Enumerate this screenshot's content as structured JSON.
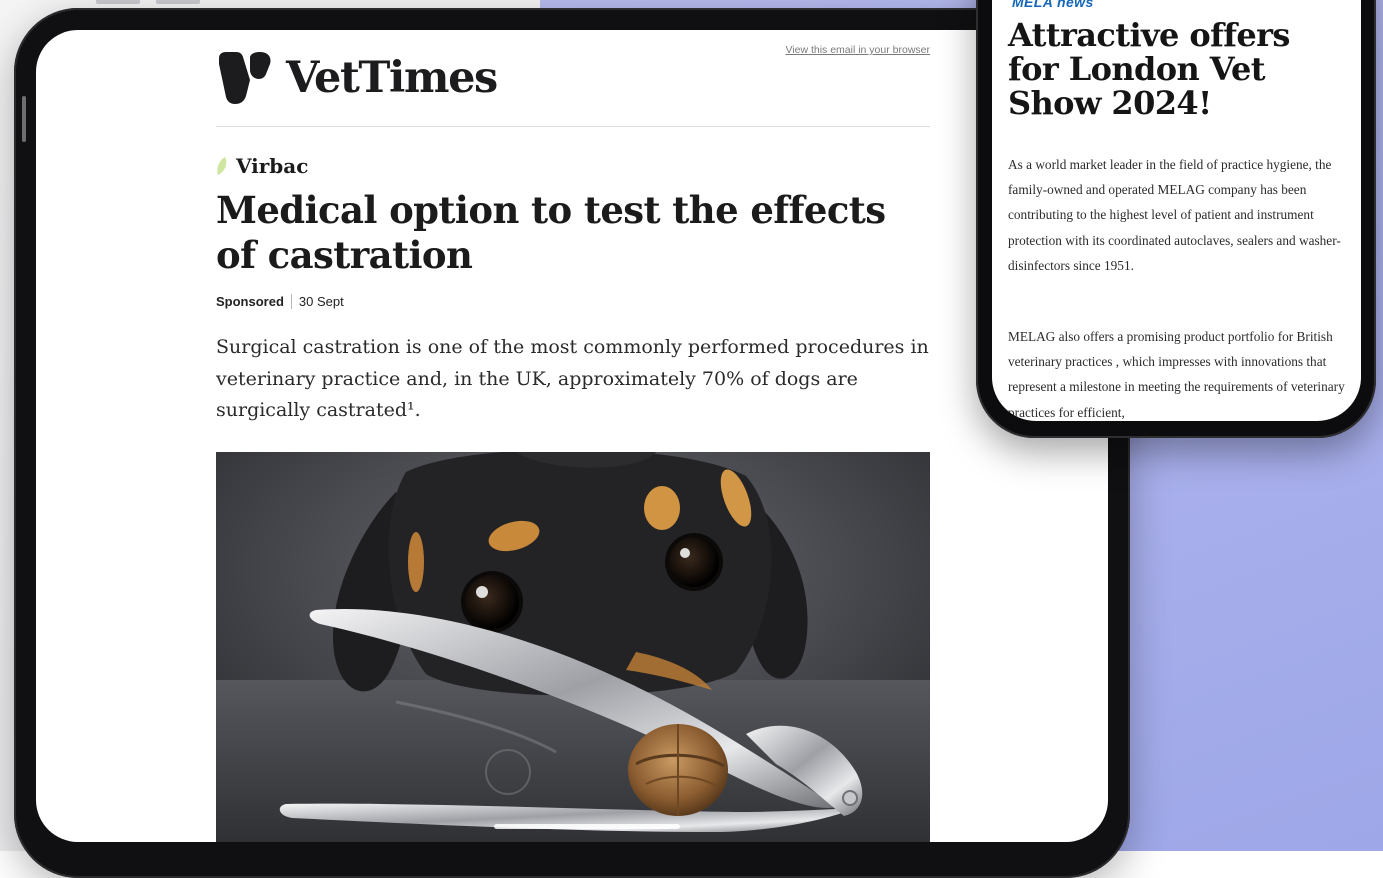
{
  "colors": {
    "accent_blue": "#1667b8",
    "background_lavender": "#aab1ec",
    "brand_text": "#1c1c1e",
    "leaf_green": "#cfe6a0"
  },
  "email": {
    "view_in_browser": "View this email in your browser",
    "brand": "VetTimes",
    "logo_icon": "vettimes-logo-icon",
    "sponsor": "Virbac",
    "headline": "Medical option to test the effects of castration",
    "meta": {
      "tag": "Sponsored",
      "date": "30 Sept"
    },
    "lede": "Surgical castration is one of the most commonly performed procedures in veterinary practice and, in the UK, approximately 70% of dogs are surgically castrated¹.",
    "hero_image_alt": "Puppy looking over a nutcracker holding a walnut"
  },
  "phone": {
    "section_label": "MELA news",
    "headline": "Attractive offers for London Vet Show 2024!",
    "paragraphs": [
      "As a world market leader in the field of practice hygiene, the family-owned and operated MELAG company has been contributing to the highest level of patient and instrument protection with its coordinated autoclaves, sealers and washer-disinfectors since 1951.",
      "MELAG also offers a promising product portfolio for British veterinary practices , which impresses with innovations that represent a milestone in meeting the requirements of veterinary practices for efficient,"
    ]
  }
}
